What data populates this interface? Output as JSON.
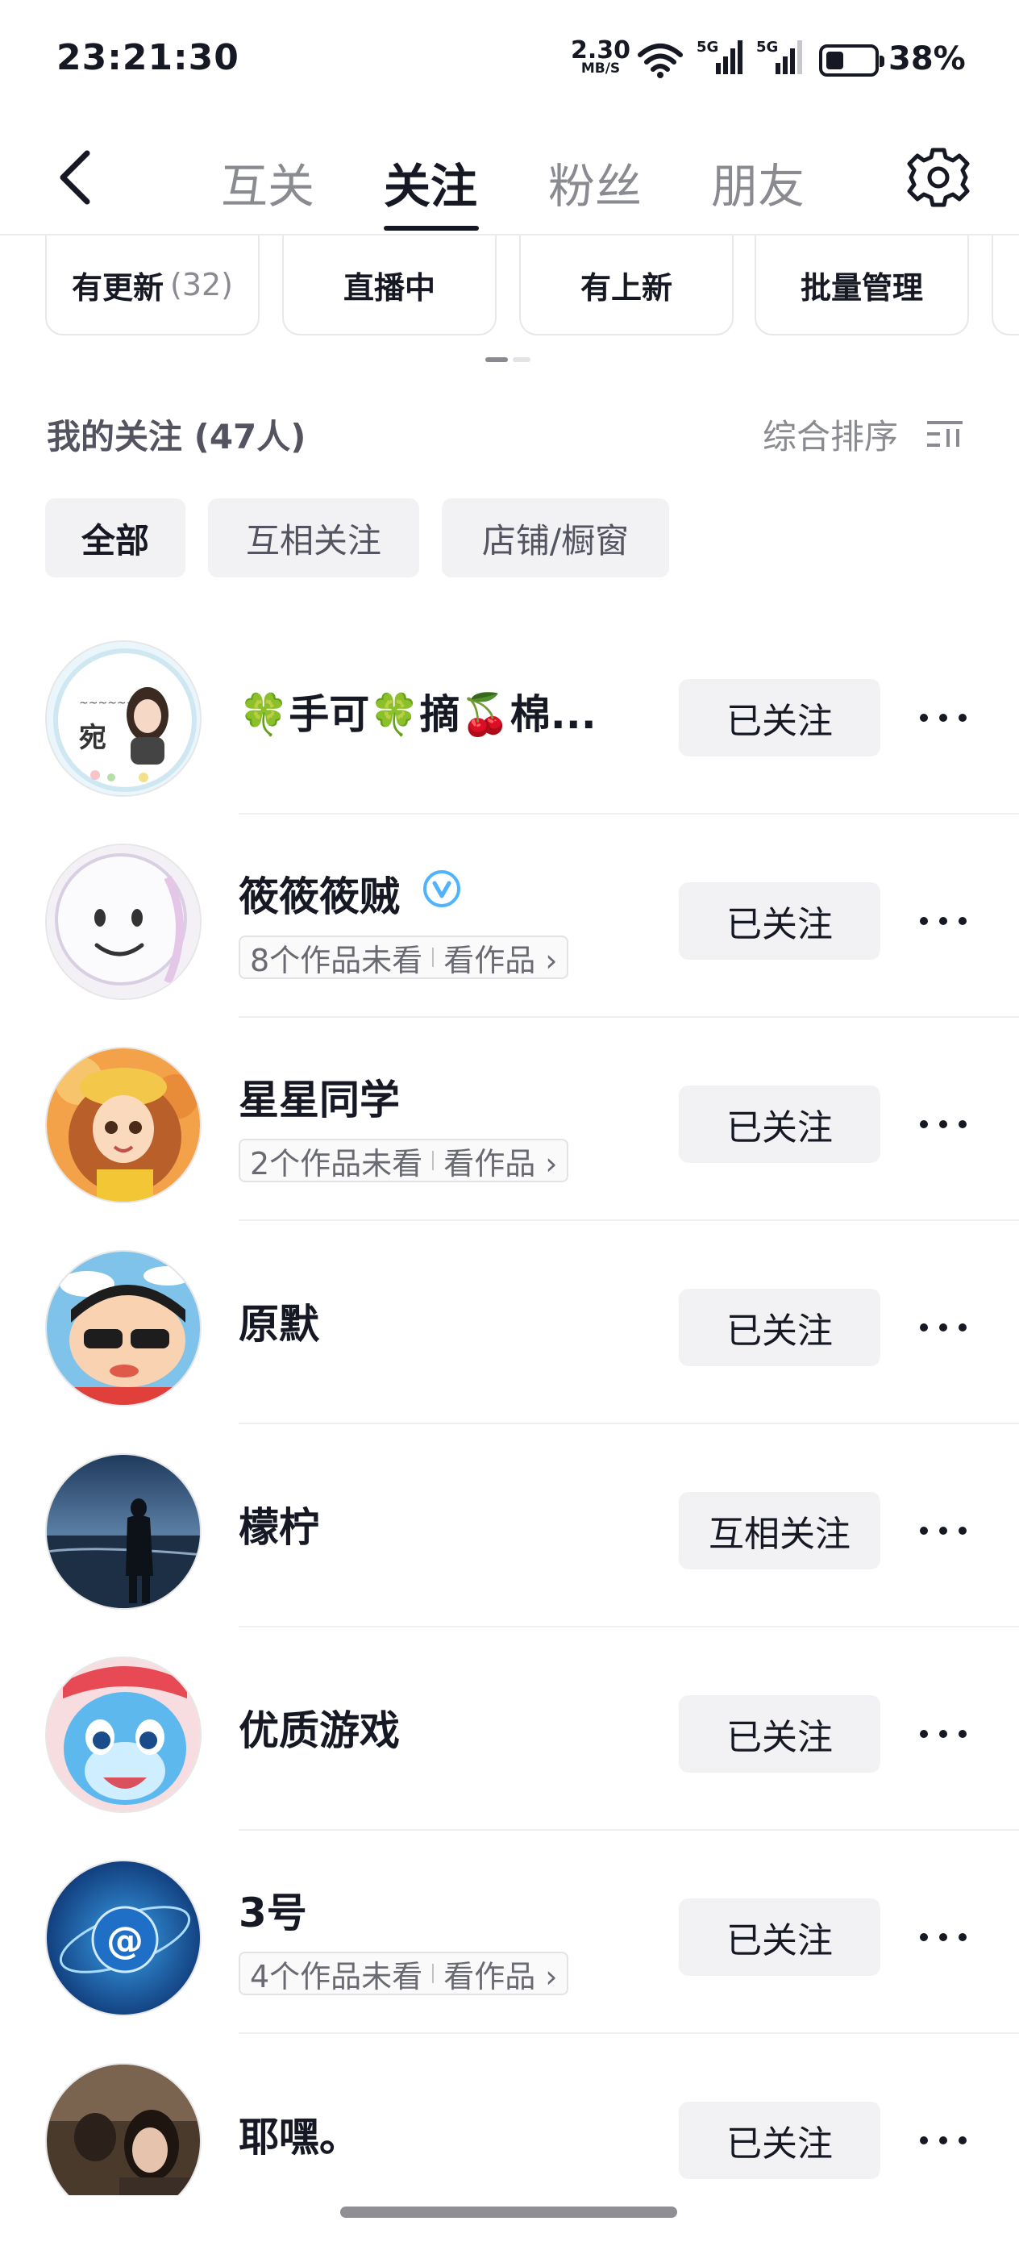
{
  "status": {
    "time": "23:21:30",
    "speed_value": "2.30",
    "speed_unit": "MB/S",
    "sim1": "5G",
    "sim2": "5G",
    "battery_percent": "38%",
    "battery_level": 0.38
  },
  "nav": {
    "tabs": [
      "互关",
      "关注",
      "粉丝",
      "朋友"
    ],
    "active_tab": "关注"
  },
  "quick_filters": [
    {
      "label": "有更新",
      "count": "(32)"
    },
    {
      "label": "直播中"
    },
    {
      "label": "有上新"
    },
    {
      "label": "批量管理"
    }
  ],
  "section": {
    "title": "我的关注 (47人)",
    "sort_label": "综合排序"
  },
  "filter_tabs": [
    "全部",
    "互相关注",
    "店铺/橱窗"
  ],
  "follow_list": [
    {
      "name": "🍀手可🍀摘🍒棉...",
      "button": "已关注",
      "tag_left": "",
      "tag_right": "",
      "avatar": "portrait-icon"
    },
    {
      "name": "筱筱筱贼",
      "verified": true,
      "button": "已关注",
      "tag_left": "8个作品未看",
      "tag_right": "看作品 ›",
      "avatar": "smiley-icon"
    },
    {
      "name": "星星同学",
      "button": "已关注",
      "tag_left": "2个作品未看",
      "tag_right": "看作品 ›",
      "avatar": "girl-cartoon-icon"
    },
    {
      "name": "原默",
      "button": "已关注",
      "tag_left": "",
      "tag_right": "",
      "avatar": "cartoon-boy-icon"
    },
    {
      "name": "檬柠",
      "button": "互相关注",
      "tag_left": "",
      "tag_right": "",
      "avatar": "seaside-silhouette-icon"
    },
    {
      "name": "优质游戏",
      "button": "已关注",
      "tag_left": "",
      "tag_right": "",
      "avatar": "blue-mascot-icon"
    },
    {
      "name": "3号",
      "button": "已关注",
      "tag_left": "4个作品未看",
      "tag_right": "看作品 ›",
      "avatar": "at-sign-globe-icon"
    },
    {
      "name": "耶嘿。",
      "button": "已关注",
      "tag_left": "",
      "tag_right": "",
      "avatar": "photo-portrait-icon"
    }
  ],
  "colors": {
    "primary_text": "#161823",
    "secondary_text": "#8a8b91",
    "chip_bg": "#f2f2f4",
    "verified": "#4fb3ff"
  }
}
